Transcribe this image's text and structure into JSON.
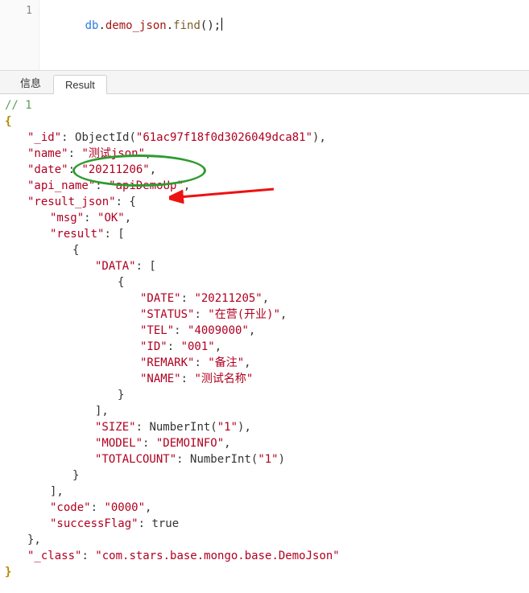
{
  "editor": {
    "line_number": "1",
    "obj": "db",
    "prop": "demo_json",
    "fn": "find",
    "tail": "();"
  },
  "tabs": {
    "info": "信息",
    "result": "Result"
  },
  "res": {
    "comment": "// 1",
    "open": "{",
    "close": "}",
    "id_key": "\"_id\"",
    "id_fn": "ObjectId",
    "id_val": "\"61ac97f18f0d3026049dca81\"",
    "name_key": "\"name\"",
    "name_val": "\"测试json\"",
    "date_key": "\"date\"",
    "date_val": "\"20211206\"",
    "api_key": "\"api_name\"",
    "api_val": "\"apiDemoUp\"",
    "rj_key": "\"result_json\"",
    "msg_key": "\"msg\"",
    "msg_val": "\"OK\"",
    "result_key": "\"result\"",
    "data_key": "\"DATA\"",
    "date2_key": "\"DATE\"",
    "date2_val": "\"20211205\"",
    "status_key": "\"STATUS\"",
    "status_val": "\"在营(开业)\"",
    "tel_key": "\"TEL\"",
    "tel_val": "\"4009000\"",
    "idk": "\"ID\"",
    "idv": "\"001\"",
    "remark_key": "\"REMARK\"",
    "remark_val": "\"备注\"",
    "name2_key": "\"NAME\"",
    "name2_val": "\"测试名称\"",
    "size_key": "\"SIZE\"",
    "ni_fn": "NumberInt",
    "ni_val": "\"1\"",
    "model_key": "\"MODEL\"",
    "model_val": "\"DEMOINFO\"",
    "tc_key": "\"TOTALCOUNT\"",
    "code_key": "\"code\"",
    "code_val": "\"0000\"",
    "sf_key": "\"successFlag\"",
    "sf_val": "true",
    "class_key": "\"_class\"",
    "class_val": "\"com.stars.base.mongo.base.DemoJson\""
  }
}
